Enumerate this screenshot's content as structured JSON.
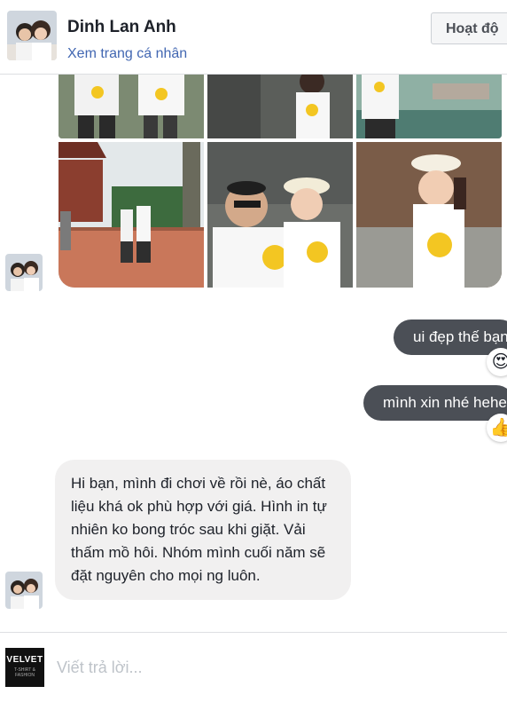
{
  "header": {
    "name": "Dinh Lan Anh",
    "profile_link": "Xem trang cá nhân",
    "action_button": "Hoạt độ"
  },
  "messages": {
    "outgoing_1": "ui đẹp thế bạn",
    "outgoing_1_reaction": "😍",
    "outgoing_2": "mình xin nhé hehe",
    "outgoing_2_reaction": "👍",
    "incoming": "Hi bạn, mình đi chơi về rồi nè, áo chất liệu khá ok phù hợp với giá. Hình in tự nhiên ko bong tróc sau khi giặt. Vải thấm mồ hôi. Nhóm mình cuối năm sẽ đặt nguyên cho mọi ng luôn."
  },
  "composer": {
    "placeholder": "Viết trả lời...",
    "avatar_brand": "VELVET",
    "avatar_sub": "T-SHIRT & FASHION"
  },
  "colors": {
    "outgoing_bubble": "#4b4f56",
    "incoming_bubble": "#f1f0f0",
    "link": "#4267b2"
  },
  "icons": {
    "reaction_1": "heart-eyes-emoji",
    "reaction_2": "thumbs-up-emoji"
  }
}
